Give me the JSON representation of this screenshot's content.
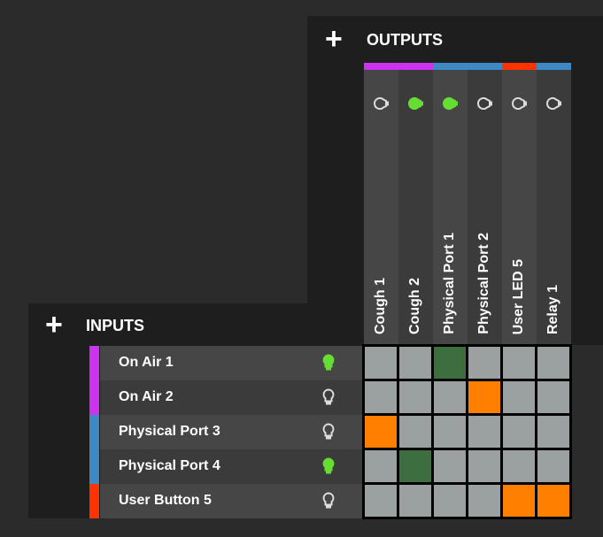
{
  "outputs_header": {
    "label": "OUTPUTS"
  },
  "inputs_header": {
    "label": "INPUTS"
  },
  "outputs": [
    {
      "label": "Cough 1",
      "lamp": "off",
      "color": "#cc33ee"
    },
    {
      "label": "Cough 2",
      "lamp": "on",
      "color": "#cc33ee"
    },
    {
      "label": "Physical Port 1",
      "lamp": "on",
      "color": "#3e88c4"
    },
    {
      "label": "Physical Port 2",
      "lamp": "off",
      "color": "#3e88c4"
    },
    {
      "label": "User LED 5",
      "lamp": "off",
      "color": "#ff3300"
    },
    {
      "label": "Relay 1",
      "lamp": "off",
      "color": "#3e88c4"
    }
  ],
  "inputs": [
    {
      "label": "On Air 1",
      "lamp": "on",
      "color": "#cc33ee"
    },
    {
      "label": "On Air 2",
      "lamp": "off",
      "color": "#cc33ee"
    },
    {
      "label": "Physical Port 3",
      "lamp": "off",
      "color": "#3e88c4"
    },
    {
      "label": "Physical Port 4",
      "lamp": "on",
      "color": "#3e88c4"
    },
    {
      "label": "User Button 5",
      "lamp": "off",
      "color": "#ff3300"
    }
  ],
  "matrix": [
    [
      "off",
      "off",
      "green",
      "off",
      "off",
      "off"
    ],
    [
      "off",
      "off",
      "off",
      "orange",
      "off",
      "off"
    ],
    [
      "orange",
      "off",
      "off",
      "off",
      "off",
      "off"
    ],
    [
      "off",
      "green",
      "off",
      "off",
      "off",
      "off"
    ],
    [
      "off",
      "off",
      "off",
      "off",
      "orange",
      "orange"
    ]
  ],
  "colors": {
    "lamp_on": "#66dd33",
    "lamp_off": "#dddddd",
    "cell_off": "#9aa1a0",
    "cell_green": "#3c6e3f",
    "cell_orange": "#ff8000"
  },
  "icons": {
    "add": "plus-icon",
    "lamp": "lightbulb-icon"
  }
}
